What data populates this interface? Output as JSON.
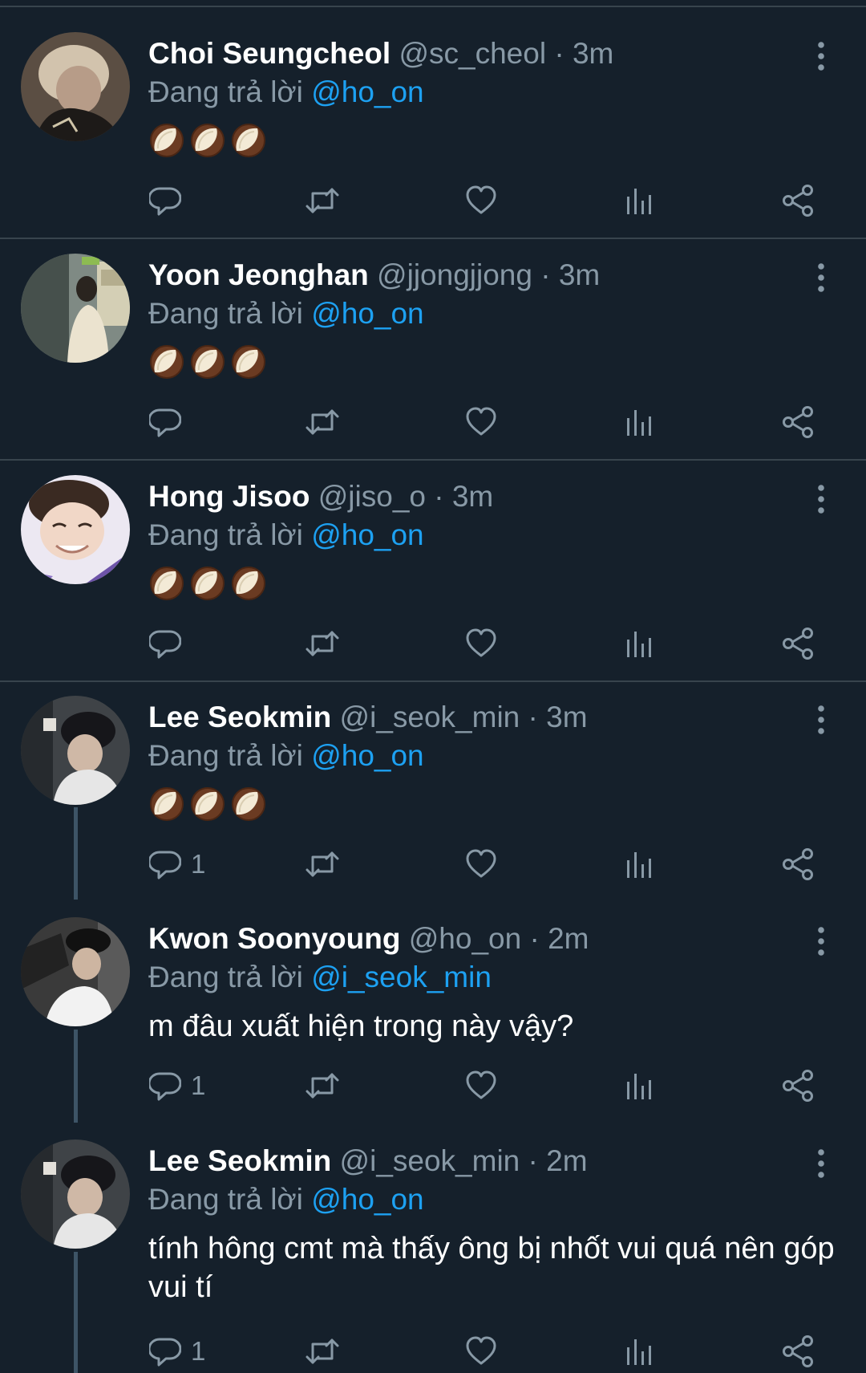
{
  "tweets": [
    {
      "name": "Choi Seungcheol",
      "handle": "@sc_cheol",
      "time": "3m",
      "replying_prefix": "Đang trả lời ",
      "replying_to": "@ho_on",
      "text": "",
      "emojis": [
        "coconut",
        "coconut",
        "coconut"
      ],
      "reply_count": ""
    },
    {
      "name": "Yoon Jeonghan",
      "handle": "@jjongjjong",
      "time": "3m",
      "replying_prefix": "Đang trả lời ",
      "replying_to": "@ho_on",
      "text": "",
      "emojis": [
        "coconut",
        "coconut",
        "coconut"
      ],
      "reply_count": ""
    },
    {
      "name": "Hong Jisoo",
      "handle": "@jiso_o",
      "time": "3m",
      "replying_prefix": "Đang trả lời ",
      "replying_to": "@ho_on",
      "text": "",
      "emojis": [
        "coconut",
        "coconut",
        "coconut"
      ],
      "reply_count": ""
    },
    {
      "name": "Lee Seokmin",
      "handle": "@i_seok_min",
      "time": "3m",
      "replying_prefix": "Đang trả lời ",
      "replying_to": "@ho_on",
      "text": "",
      "emojis": [
        "coconut",
        "coconut",
        "coconut"
      ],
      "reply_count": "1"
    },
    {
      "name": "Kwon Soonyoung",
      "handle": "@ho_on",
      "time": "2m",
      "replying_prefix": "Đang trả lời ",
      "replying_to": "@i_seok_min",
      "text": "m đâu xuất hiện trong này vậy?",
      "emojis": [],
      "reply_count": "1"
    },
    {
      "name": "Lee Seokmin",
      "handle": "@i_seok_min",
      "time": "2m",
      "replying_prefix": "Đang trả lời ",
      "replying_to": "@ho_on",
      "text": "tính hông cmt mà thấy ông bị nhốt vui quá nên góp vui tí",
      "emojis": [],
      "reply_count": "1"
    }
  ],
  "separator": " · ",
  "colors": {
    "background": "#15202b",
    "primary_text": "#ffffff",
    "secondary_text": "#8899a6",
    "link": "#1da1f2",
    "divider": "#38444d",
    "thread_line": "#3d5466"
  },
  "icons": [
    "reply-icon",
    "retweet-icon",
    "like-icon",
    "analytics-icon",
    "share-icon",
    "more-icon"
  ]
}
